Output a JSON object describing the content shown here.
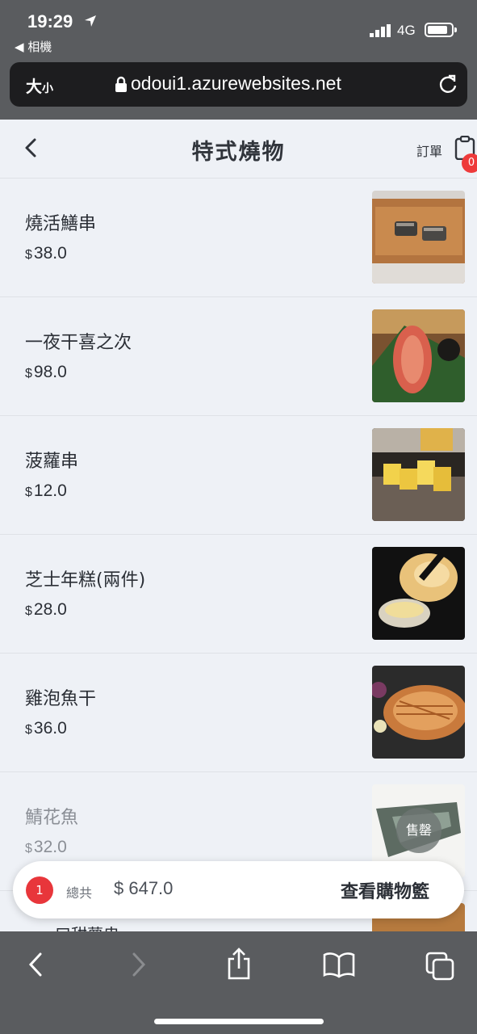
{
  "status_bar": {
    "time": "19:29",
    "back_app": "◀ 相機",
    "network": "4G"
  },
  "browser": {
    "text_size": "大",
    "text_size_small": "小",
    "url": "odoui1.azurewebsites.net"
  },
  "header": {
    "title": "特式燒物",
    "order_label": "訂單",
    "order_count": "0"
  },
  "items": [
    {
      "name": "燒活鱔串",
      "currency": "$",
      "price": "38.0",
      "sold_out": false
    },
    {
      "name": "一夜干喜之次",
      "currency": "$",
      "price": "98.0",
      "sold_out": false
    },
    {
      "name": "菠蘿串",
      "currency": "$",
      "price": "12.0",
      "sold_out": false
    },
    {
      "name": "芝士年糕(兩件)",
      "currency": "$",
      "price": "28.0",
      "sold_out": false
    },
    {
      "name": "雞泡魚干",
      "currency": "$",
      "price": "36.0",
      "sold_out": false
    },
    {
      "name": "鯖花魚",
      "currency": "$",
      "price": "32.0",
      "sold_out": true,
      "sold_out_label": "售罄"
    }
  ],
  "partial_item": {
    "name": "一口甜薯串"
  },
  "cart": {
    "count": "1",
    "total_label": "總共",
    "total_value": "$ 647.0",
    "view_cart_label": "查看購物籃"
  },
  "colors": {
    "accent_red": "#e8363b",
    "page_bg": "#eef1f6",
    "chrome_gray": "#5a5c5f"
  }
}
